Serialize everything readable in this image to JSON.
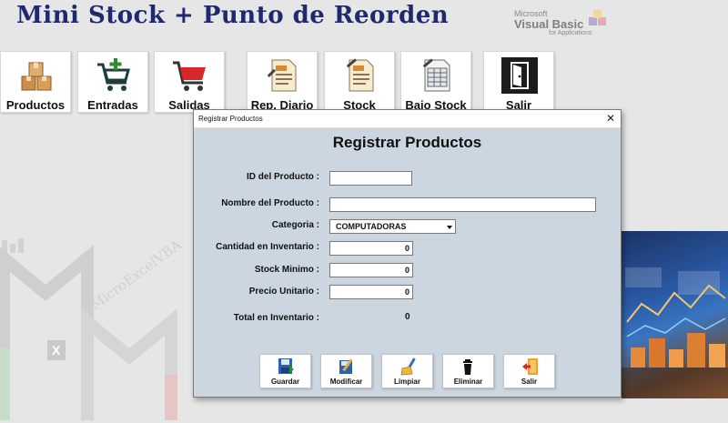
{
  "header": {
    "title": "Mini Stock  +  Punto de Reorden",
    "vba_logo": {
      "line1": "Microsoft",
      "line2": "Visual Basic",
      "line3": "for Applications"
    }
  },
  "toolbar": {
    "buttons": [
      {
        "label": "Productos",
        "icon": "boxes-icon"
      },
      {
        "label": "Entradas",
        "icon": "cart-add-icon"
      },
      {
        "label": "Salidas",
        "icon": "cart-icon"
      },
      {
        "label": "Rep. Diario",
        "icon": "report-icon"
      },
      {
        "label": "Stock",
        "icon": "document-icon"
      },
      {
        "label": "Bajo Stock",
        "icon": "spreadsheet-icon"
      },
      {
        "label": "Salir",
        "icon": "exit-door-icon"
      }
    ]
  },
  "watermark": {
    "text": "MicroExcelVBA"
  },
  "dialog": {
    "window_title": "Registrar Productos",
    "close_symbol": "✕",
    "heading": "Registrar Productos",
    "fields": {
      "id": {
        "label": "ID del Producto :",
        "value": ""
      },
      "nombre": {
        "label": "Nombre del Producto :",
        "value": ""
      },
      "categoria": {
        "label": "Categoria :",
        "value": "COMPUTADORAS"
      },
      "cantidad": {
        "label": "Cantidad en Inventario :",
        "value": "0"
      },
      "stock_minimo": {
        "label": "Stock Minimo :",
        "value": "0"
      },
      "precio": {
        "label": "Precio Unitario :",
        "value": "0"
      },
      "total": {
        "label": "Total en Inventario :",
        "value": "0"
      }
    },
    "actions": [
      {
        "label": "Guardar",
        "icon": "save-icon"
      },
      {
        "label": "Modificar",
        "icon": "edit-icon"
      },
      {
        "label": "Limpiar",
        "icon": "broom-icon"
      },
      {
        "label": "Eliminar",
        "icon": "trash-icon"
      },
      {
        "label": "Salir",
        "icon": "exit-icon"
      }
    ]
  },
  "colors": {
    "title": "#1f2a6e",
    "dialog_bg": "#ccd6e0",
    "cart_green": "#2e8b2e",
    "cart_red": "#d9262a"
  }
}
